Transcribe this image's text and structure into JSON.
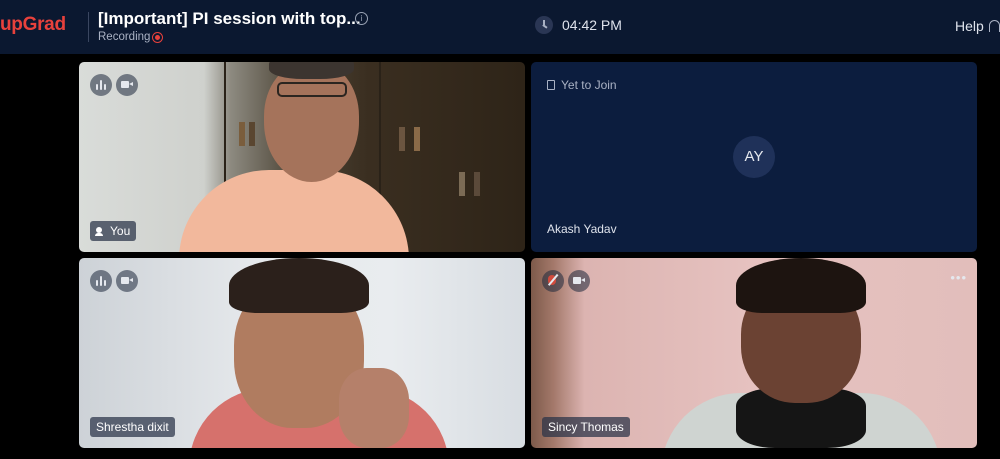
{
  "header": {
    "logo": "upGrad",
    "title": "[Important] PI session with top...",
    "status": "Recording",
    "time": "04:42 PM",
    "help": "Help"
  },
  "tiles": [
    {
      "name": "You",
      "state": "video",
      "mic": "on",
      "camera": "on"
    },
    {
      "name": "Akash Yadav",
      "state": "Yet to Join",
      "initials": "AY"
    },
    {
      "name": "Shrestha dixit",
      "state": "video",
      "mic": "on",
      "camera": "on"
    },
    {
      "name": "Sincy Thomas",
      "state": "video",
      "mic": "muted",
      "camera": "on",
      "more": "•••"
    }
  ],
  "colors": {
    "header_bg": "#0b1830",
    "accent": "#e8413c",
    "tile_bg": "#0c1d3e"
  }
}
